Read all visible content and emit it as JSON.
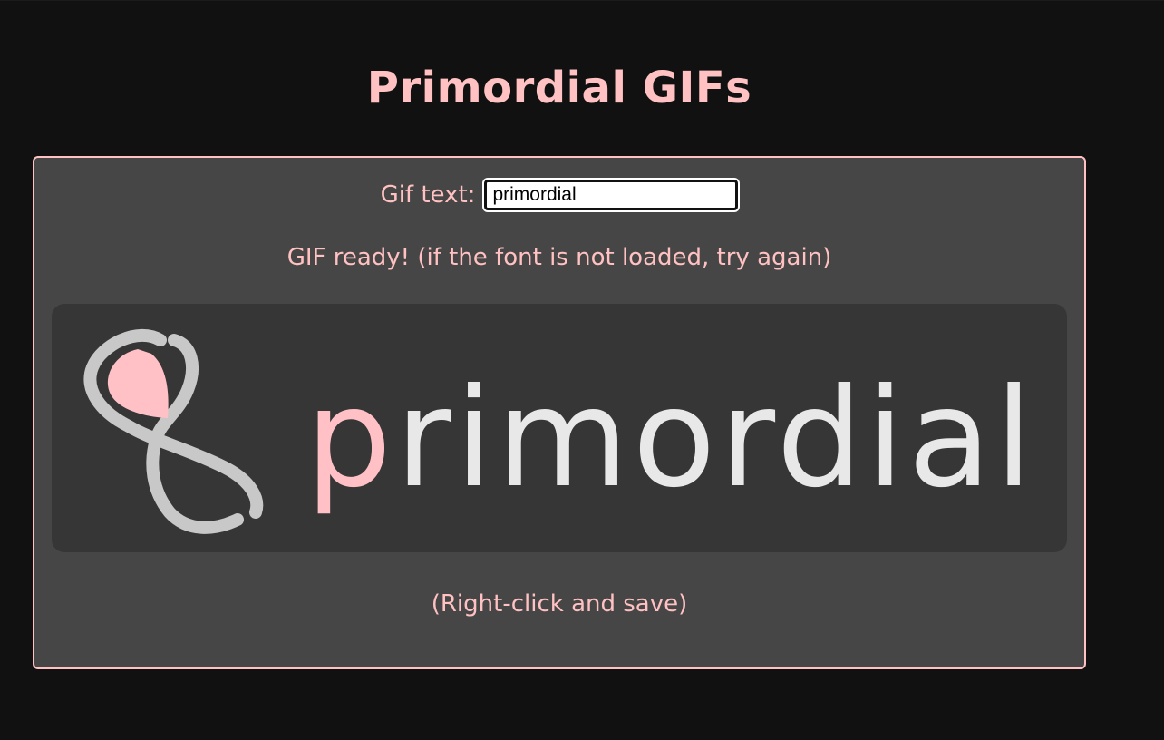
{
  "page": {
    "title": "Primordial GIFs"
  },
  "form": {
    "label": "Gif text:",
    "input_value": "primordial"
  },
  "status_text": "GIF ready! (if the font is not loaded, try again)",
  "gif": {
    "first_letter": "p",
    "rest_text": "rimordial",
    "accent_color": "#ffc1c6",
    "text_color": "#e8e8e8",
    "logo_color": "#c8c8c8"
  },
  "hint_text": "(Right-click and save)"
}
